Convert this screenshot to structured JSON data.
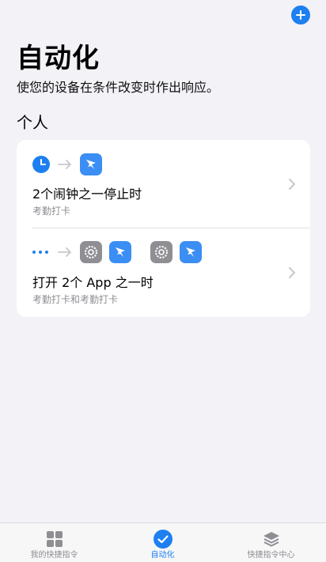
{
  "header": {
    "add_icon": "plus-circle-icon"
  },
  "page": {
    "title": "自动化",
    "subtitle": "使您的设备在条件改变时作出响应。"
  },
  "section": {
    "title": "个人"
  },
  "automations": [
    {
      "trigger_icon": "clock-icon",
      "action_icons": [
        "dingtalk-app-icon"
      ],
      "title": "2个闹钟之一停止时",
      "subtitle": "考勤打卡"
    },
    {
      "trigger_icon": "more-dots-icon",
      "action_icons": [
        "settings-app-icon",
        "dingtalk-app-icon",
        "settings-app-icon",
        "dingtalk-app-icon"
      ],
      "title": "打开 2个 App 之一时",
      "subtitle": "考勤打卡和考勤打卡"
    }
  ],
  "tabbar": {
    "tabs": [
      {
        "label": "我的快捷指令",
        "icon": "grid-icon",
        "active": false
      },
      {
        "label": "自动化",
        "icon": "checkmark-circle-icon",
        "active": true
      },
      {
        "label": "快捷指令中心",
        "icon": "layers-icon",
        "active": false
      }
    ]
  },
  "colors": {
    "accent": "#1e7ff0",
    "background": "#f2f2f7",
    "card": "#ffffff",
    "secondary_text": "#8e8e93",
    "app_blue": "#3b8ef3",
    "settings_gray": "#8e8e93"
  }
}
